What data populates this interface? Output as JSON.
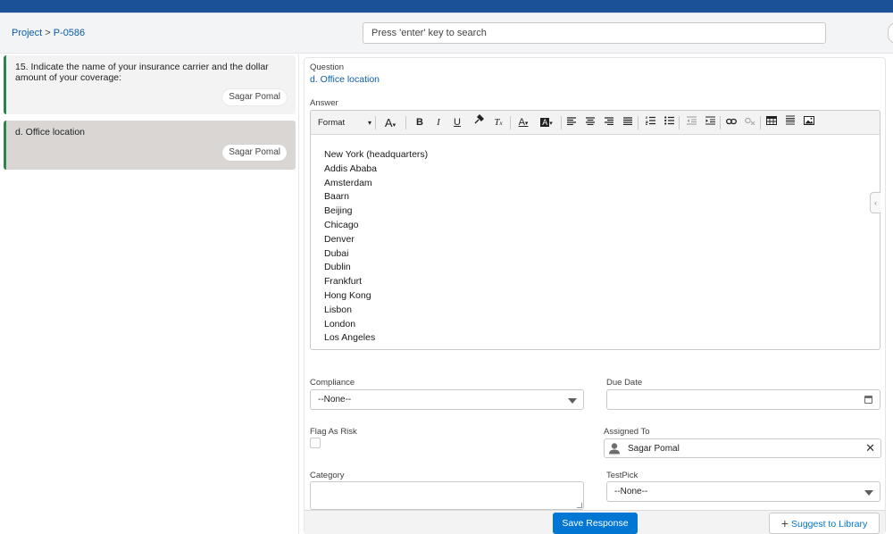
{
  "header": {
    "breadcrumb": [
      "Project",
      "P-0586"
    ],
    "breadcrumb_separator": ">",
    "search_placeholder": "Press 'enter' key to search"
  },
  "questions": [
    {
      "text": "15. Indicate the name of your insurance carrier and the dollar amount of your coverage:",
      "assignee": "Sagar Pomal",
      "selected": false
    },
    {
      "text": "d. Office location",
      "assignee": "Sagar Pomal",
      "selected": true
    }
  ],
  "detail": {
    "question_label": "Question",
    "question_value": "d. Office location",
    "answer_label": "Answer",
    "format_label": "Format",
    "answer_lines": [
      "New York (headquarters)",
      "Addis Ababa",
      "Amsterdam",
      "Baarn",
      "Beijing",
      "Chicago",
      "Denver",
      "Dubai",
      "Dublin",
      "Frankfurt",
      "Hong Kong",
      "Lisbon",
      "London",
      "Los Angeles"
    ],
    "compliance_label": "Compliance",
    "compliance_value": "--None--",
    "due_date_label": "Due Date",
    "due_date_value": "",
    "flag_label": "Flag As Risk",
    "assigned_label": "Assigned To",
    "assigned_value": "Sagar Pomal",
    "category_label": "Category",
    "testpick_label": "TestPick",
    "testpick_value": "--None--"
  },
  "footer": {
    "save_label": "Save Response",
    "suggest_label": "Suggest to Library"
  },
  "colors": {
    "brand_blue": "#0176d3",
    "topbar": "#1b5297",
    "selected_accent": "#2e844a"
  },
  "icons": [
    "font-color-icon",
    "bold-icon",
    "italic-icon",
    "underline-icon",
    "format-painter-icon",
    "clear-format-icon",
    "text-color-icon",
    "background-color-icon",
    "align-left-icon",
    "align-center-icon",
    "align-right-icon",
    "justify-icon",
    "numbered-list-icon",
    "bulleted-list-icon",
    "indent-icon",
    "outdent-icon",
    "link-icon",
    "unlink-icon",
    "table-icon",
    "horizontal-rule-icon",
    "image-icon",
    "calendar-icon",
    "user-icon",
    "close-icon",
    "add-icon"
  ]
}
